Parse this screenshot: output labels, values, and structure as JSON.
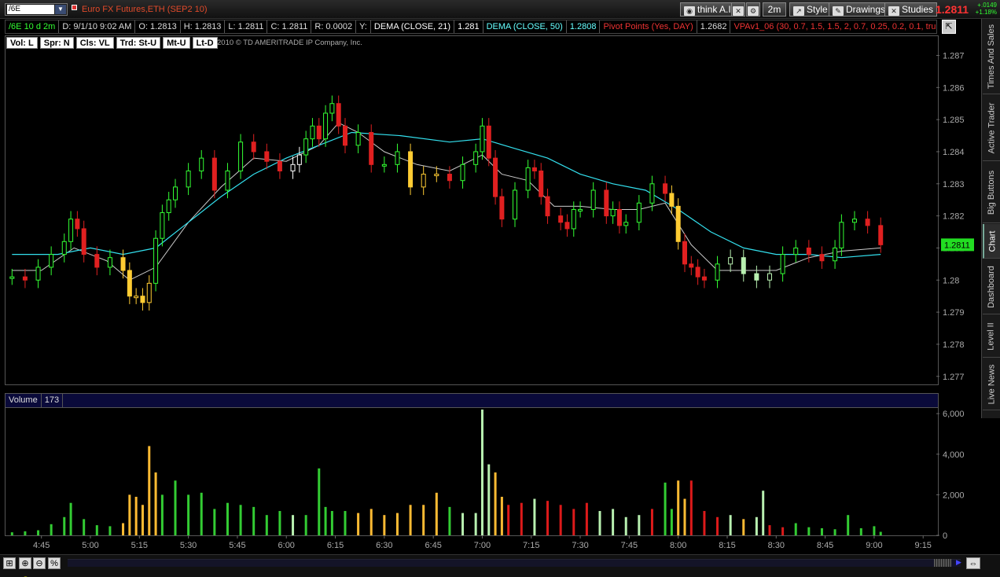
{
  "toolbar": {
    "symbol": "/6E",
    "instrument_name": "Euro FX Futures,ETH (SEP2 10)",
    "think_ai_label": "think A.I.",
    "timeframe_label": "2m",
    "style_label": "Style",
    "drawings_label": "Drawings",
    "studies_label": "Studies",
    "last_price": "1.2811",
    "net_change": "+.0149",
    "pct_change": "+1.18%"
  },
  "infobar": {
    "symbol_period": "/6E 10 d 2m",
    "date": "D: 9/1/10 9:02 AM",
    "open": "O: 1.2813",
    "high": "H: 1.2813",
    "low": "L: 1.2811",
    "close": "C: 1.2811",
    "range": "R: 0.0002",
    "y": "Y:",
    "dema21_label": "DEMA (CLOSE, 21)",
    "dema21_value": "1.281",
    "dema50_label": "DEMA (CLOSE, 50)",
    "dema50_value": "1.2808",
    "pivot_label": "Pivot Points (Yes, DAY)",
    "pivot_value": "1.2682",
    "vpa_label": "VPAv1_06 (30, 0.7, 1.5, 1.5, 2, 0.7, 0.25, 0.2, 0.1, true, tr..."
  },
  "tags": [
    "Vol: L",
    "Spr: N",
    "Cls: VL",
    "Trd: St-U",
    "Mt-U",
    "Lt-D"
  ],
  "copyright": "2010 © TD AMERITRADE IP Company, Inc.",
  "volume_header": {
    "label": "Volume",
    "value": "173"
  },
  "side_tabs": [
    "Times And Sales",
    "Active Trader",
    "Big Buttons",
    "Chart",
    "Dashboard",
    "Level II",
    "Live News"
  ],
  "colors": {
    "accent_red": "#ff3333",
    "up_green": "#33ff33",
    "yellow": "#ffcc33",
    "red_bar": "#e02020",
    "pale_green": "#b8f0b0",
    "dema_fast": "#ffffff",
    "dema_slow": "#33e0ee"
  },
  "chart_data": [
    {
      "type": "candlestick",
      "title": "Euro FX Futures,ETH (SEP2 10)",
      "x_ticks": [
        "4:45",
        "5:00",
        "5:15",
        "5:30",
        "5:45",
        "6:00",
        "6:15",
        "6:30",
        "6:45",
        "7:00",
        "7:15",
        "7:30",
        "7:45",
        "8:00",
        "8:15",
        "8:30",
        "8:45",
        "9:00",
        "9:15"
      ],
      "y_ticks": [
        1.277,
        1.278,
        1.279,
        1.28,
        1.281,
        1.282,
        1.283,
        1.284,
        1.285,
        1.286,
        1.287
      ],
      "y_tick_labels": [
        "1.277",
        "1.278",
        "1.279",
        "1.28",
        "1.281",
        "1.282",
        "1.283",
        "1.284",
        "1.285",
        "1.286",
        "1.287"
      ],
      "ylim": [
        1.2767,
        1.2876
      ],
      "xlim": [
        "4:34",
        "9:20"
      ],
      "last_price_label": "1.2811",
      "closes": [
        [
          "4:36",
          1.2801
        ],
        [
          "4:40",
          1.28
        ],
        [
          "4:44",
          1.2804
        ],
        [
          "4:48",
          1.2808
        ],
        [
          "4:52",
          1.2812
        ],
        [
          "4:54",
          1.2819
        ],
        [
          "4:56",
          1.2816
        ],
        [
          "4:58",
          1.2808
        ],
        [
          "5:02",
          1.2804
        ],
        [
          "5:06",
          1.2807
        ],
        [
          "5:10",
          1.2803
        ],
        [
          "5:12",
          1.2795
        ],
        [
          "5:14",
          1.2795
        ],
        [
          "5:16",
          1.2793
        ],
        [
          "5:18",
          1.2799
        ],
        [
          "5:20",
          1.2813
        ],
        [
          "5:22",
          1.2821
        ],
        [
          "5:24",
          1.2825
        ],
        [
          "5:26",
          1.2829
        ],
        [
          "5:30",
          1.2834
        ],
        [
          "5:34",
          1.2838
        ],
        [
          "5:38",
          1.2828
        ],
        [
          "5:42",
          1.2834
        ],
        [
          "5:46",
          1.2843
        ],
        [
          "5:50",
          1.284
        ],
        [
          "5:54",
          1.2837
        ],
        [
          "5:58",
          1.2834
        ],
        [
          "6:02",
          1.2836
        ],
        [
          "6:04",
          1.2839
        ],
        [
          "6:06",
          1.2844
        ],
        [
          "6:08",
          1.2848
        ],
        [
          "6:10",
          1.2844
        ],
        [
          "6:12",
          1.2852
        ],
        [
          "6:14",
          1.2855
        ],
        [
          "6:16",
          1.2848
        ],
        [
          "6:18",
          1.2842
        ],
        [
          "6:22",
          1.2846
        ],
        [
          "6:26",
          1.2836
        ],
        [
          "6:30",
          1.2836
        ],
        [
          "6:34",
          1.284
        ],
        [
          "6:38",
          1.2829
        ],
        [
          "6:42",
          1.2833
        ],
        [
          "6:46",
          1.2833
        ],
        [
          "6:50",
          1.2831
        ],
        [
          "6:54",
          1.2836
        ],
        [
          "6:58",
          1.284
        ],
        [
          "7:00",
          1.2848
        ],
        [
          "7:02",
          1.2838
        ],
        [
          "7:04",
          1.2826
        ],
        [
          "7:06",
          1.2819
        ],
        [
          "7:10",
          1.2828
        ],
        [
          "7:14",
          1.2835
        ],
        [
          "7:16",
          1.2834
        ],
        [
          "7:18",
          1.2826
        ],
        [
          "7:20",
          1.282
        ],
        [
          "7:24",
          1.2818
        ],
        [
          "7:26",
          1.2816
        ],
        [
          "7:28",
          1.2822
        ],
        [
          "7:30",
          1.2822
        ],
        [
          "7:34",
          1.2828
        ],
        [
          "7:38",
          1.282
        ],
        [
          "7:40",
          1.2822
        ],
        [
          "7:42",
          1.2817
        ],
        [
          "7:44",
          1.2818
        ],
        [
          "7:48",
          1.2824
        ],
        [
          "7:52",
          1.283
        ],
        [
          "7:56",
          1.2827
        ],
        [
          "7:58",
          1.2823
        ],
        [
          "8:00",
          1.2812
        ],
        [
          "8:02",
          1.2805
        ],
        [
          "8:04",
          1.2804
        ],
        [
          "8:06",
          1.2801
        ],
        [
          "8:08",
          1.28
        ],
        [
          "8:12",
          1.2805
        ],
        [
          "8:16",
          1.2807
        ],
        [
          "8:20",
          1.2802
        ],
        [
          "8:24",
          1.28
        ],
        [
          "8:28",
          1.2802
        ],
        [
          "8:32",
          1.2808
        ],
        [
          "8:36",
          1.281
        ],
        [
          "8:40",
          1.2808
        ],
        [
          "8:44",
          1.2806
        ],
        [
          "8:48",
          1.281
        ],
        [
          "8:50",
          1.2818
        ],
        [
          "8:54",
          1.2819
        ],
        [
          "8:58",
          1.2817
        ],
        [
          "9:02",
          1.2811
        ]
      ],
      "series": [
        {
          "name": "DEMA (CLOSE, 21)",
          "points": [
            [
              "4:36",
              1.2803
            ],
            [
              "4:45",
              1.2803
            ],
            [
              "4:55",
              1.281
            ],
            [
              "5:05",
              1.2806
            ],
            [
              "5:12",
              1.28
            ],
            [
              "5:20",
              1.2804
            ],
            [
              "5:30",
              1.2818
            ],
            [
              "5:40",
              1.2829
            ],
            [
              "5:50",
              1.2838
            ],
            [
              "6:00",
              1.2837
            ],
            [
              "6:10",
              1.2842
            ],
            [
              "6:16",
              1.2849
            ],
            [
              "6:22",
              1.2846
            ],
            [
              "6:30",
              1.284
            ],
            [
              "6:40",
              1.2836
            ],
            [
              "6:50",
              1.2834
            ],
            [
              "7:00",
              1.2839
            ],
            [
              "7:06",
              1.2833
            ],
            [
              "7:14",
              1.2831
            ],
            [
              "7:22",
              1.2823
            ],
            [
              "7:30",
              1.2823
            ],
            [
              "7:40",
              1.2822
            ],
            [
              "7:48",
              1.2822
            ],
            [
              "7:56",
              1.2824
            ],
            [
              "8:04",
              1.2811
            ],
            [
              "8:12",
              1.2803
            ],
            [
              "8:20",
              1.2803
            ],
            [
              "8:30",
              1.2803
            ],
            [
              "8:40",
              1.2807
            ],
            [
              "8:50",
              1.2809
            ],
            [
              "9:02",
              1.281
            ]
          ]
        },
        {
          "name": "DEMA (CLOSE, 50)",
          "points": [
            [
              "4:36",
              1.2808
            ],
            [
              "4:50",
              1.2808
            ],
            [
              "5:00",
              1.281
            ],
            [
              "5:10",
              1.2808
            ],
            [
              "5:20",
              1.281
            ],
            [
              "5:30",
              1.2818
            ],
            [
              "5:40",
              1.2826
            ],
            [
              "5:50",
              1.2833
            ],
            [
              "6:00",
              1.2838
            ],
            [
              "6:10",
              1.2842
            ],
            [
              "6:20",
              1.2846
            ],
            [
              "6:35",
              1.2845
            ],
            [
              "6:50",
              1.2843
            ],
            [
              "7:00",
              1.2844
            ],
            [
              "7:10",
              1.2841
            ],
            [
              "7:20",
              1.2838
            ],
            [
              "7:30",
              1.2833
            ],
            [
              "7:40",
              1.283
            ],
            [
              "7:50",
              1.2828
            ],
            [
              "8:00",
              1.2822
            ],
            [
              "8:10",
              1.2815
            ],
            [
              "8:20",
              1.281
            ],
            [
              "8:30",
              1.2808
            ],
            [
              "8:40",
              1.2808
            ],
            [
              "8:50",
              1.2807
            ],
            [
              "9:02",
              1.2808
            ]
          ]
        }
      ]
    },
    {
      "type": "bar",
      "title": "Volume",
      "y_ticks": [
        0,
        2000,
        4000,
        6000
      ],
      "y_tick_labels": [
        "0",
        "2,000",
        "4,000",
        "6,000"
      ],
      "ylim": [
        0,
        6200
      ],
      "values": [
        [
          "4:36",
          150,
          "green"
        ],
        [
          "4:40",
          200,
          "green"
        ],
        [
          "4:44",
          250,
          "green"
        ],
        [
          "4:48",
          550,
          "green"
        ],
        [
          "4:52",
          900,
          "green"
        ],
        [
          "4:54",
          1600,
          "green"
        ],
        [
          "4:58",
          800,
          "green"
        ],
        [
          "5:02",
          500,
          "green"
        ],
        [
          "5:06",
          450,
          "green"
        ],
        [
          "5:10",
          600,
          "yellow"
        ],
        [
          "5:12",
          2000,
          "yellow"
        ],
        [
          "5:14",
          1900,
          "yellow"
        ],
        [
          "5:16",
          1500,
          "yellow"
        ],
        [
          "5:18",
          4400,
          "yellow"
        ],
        [
          "5:20",
          3100,
          "yellow"
        ],
        [
          "5:22",
          2000,
          "green"
        ],
        [
          "5:26",
          2700,
          "green"
        ],
        [
          "5:30",
          2000,
          "green"
        ],
        [
          "5:34",
          2100,
          "green"
        ],
        [
          "5:38",
          1300,
          "green"
        ],
        [
          "5:42",
          1600,
          "green"
        ],
        [
          "5:46",
          1500,
          "green"
        ],
        [
          "5:50",
          1400,
          "green"
        ],
        [
          "5:54",
          1000,
          "green"
        ],
        [
          "5:58",
          1200,
          "green"
        ],
        [
          "6:02",
          1000,
          "pale"
        ],
        [
          "6:06",
          1000,
          "green"
        ],
        [
          "6:10",
          3300,
          "green"
        ],
        [
          "6:12",
          1400,
          "green"
        ],
        [
          "6:14",
          1200,
          "green"
        ],
        [
          "6:18",
          1200,
          "green"
        ],
        [
          "6:22",
          1100,
          "yellow"
        ],
        [
          "6:26",
          1300,
          "yellow"
        ],
        [
          "6:30",
          1000,
          "yellow"
        ],
        [
          "6:34",
          1100,
          "yellow"
        ],
        [
          "6:38",
          1500,
          "yellow"
        ],
        [
          "6:42",
          1500,
          "yellow"
        ],
        [
          "6:46",
          2100,
          "yellow"
        ],
        [
          "6:50",
          1400,
          "green"
        ],
        [
          "6:54",
          1100,
          "pale"
        ],
        [
          "6:58",
          1100,
          "pale"
        ],
        [
          "7:00",
          6200,
          "pale"
        ],
        [
          "7:02",
          3500,
          "pale"
        ],
        [
          "7:04",
          3100,
          "yellow"
        ],
        [
          "7:06",
          1900,
          "yellow"
        ],
        [
          "7:08",
          1500,
          "red"
        ],
        [
          "7:12",
          1600,
          "red"
        ],
        [
          "7:16",
          1800,
          "pale"
        ],
        [
          "7:20",
          1700,
          "red"
        ],
        [
          "7:24",
          1500,
          "red"
        ],
        [
          "7:28",
          1300,
          "red"
        ],
        [
          "7:32",
          1600,
          "red"
        ],
        [
          "7:36",
          1200,
          "pale"
        ],
        [
          "7:40",
          1300,
          "pale"
        ],
        [
          "7:44",
          900,
          "pale"
        ],
        [
          "7:48",
          1000,
          "pale"
        ],
        [
          "7:52",
          1300,
          "red"
        ],
        [
          "7:56",
          2600,
          "green"
        ],
        [
          "7:58",
          1300,
          "green"
        ],
        [
          "8:00",
          2700,
          "yellow"
        ],
        [
          "8:02",
          1800,
          "yellow"
        ],
        [
          "8:04",
          2700,
          "red"
        ],
        [
          "8:08",
          1200,
          "red"
        ],
        [
          "8:12",
          900,
          "red"
        ],
        [
          "8:16",
          1000,
          "pale"
        ],
        [
          "8:20",
          800,
          "yellow"
        ],
        [
          "8:24",
          900,
          "pale"
        ],
        [
          "8:26",
          2200,
          "pale"
        ],
        [
          "8:28",
          500,
          "red"
        ],
        [
          "8:32",
          400,
          "red"
        ],
        [
          "8:36",
          600,
          "green"
        ],
        [
          "8:40",
          400,
          "green"
        ],
        [
          "8:44",
          350,
          "green"
        ],
        [
          "8:48",
          300,
          "green"
        ],
        [
          "8:52",
          1000,
          "green"
        ],
        [
          "8:56",
          350,
          "green"
        ],
        [
          "9:00",
          450,
          "green"
        ],
        [
          "9:02",
          173,
          "green"
        ]
      ]
    }
  ]
}
